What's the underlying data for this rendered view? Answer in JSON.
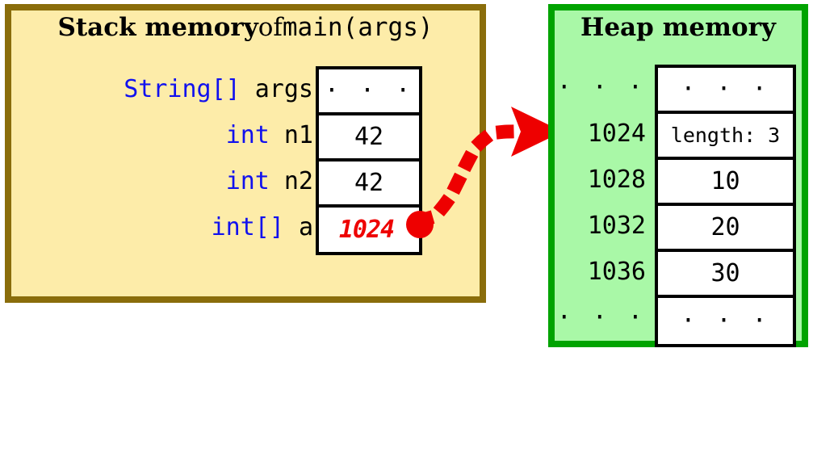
{
  "colors": {
    "stack_fill": "#fdeca9",
    "stack_border": "#8a6d0b",
    "heap_fill": "#a9f8a7",
    "heap_border": "#00a300",
    "pointer_red": "#ee0000",
    "type_blue": "#1111ee",
    "text_black": "#000000",
    "cell_fill": "#ffffff"
  },
  "stack": {
    "title": {
      "bold_part": "Stack memory",
      "middle_part": " of ",
      "mono_part": "main(args)"
    },
    "rows": [
      {
        "type": "String[]",
        "name": "args",
        "value": "· · ·",
        "value_style": "dots"
      },
      {
        "type": "int",
        "name": "n1",
        "value": "42",
        "value_style": "plain"
      },
      {
        "type": "int",
        "name": "n2",
        "value": "42",
        "value_style": "plain"
      },
      {
        "type": "int[]",
        "name": "a",
        "value": "1024",
        "value_style": "pointer"
      }
    ]
  },
  "heap": {
    "title": "Heap memory",
    "rows": [
      {
        "address": "· · ·",
        "value": "· · ·",
        "value_style": "dots"
      },
      {
        "address": "1024",
        "value": "length: 3",
        "value_style": "length"
      },
      {
        "address": "1028",
        "value": "10",
        "value_style": "plain"
      },
      {
        "address": "1032",
        "value": "20",
        "value_style": "plain"
      },
      {
        "address": "1036",
        "value": "30",
        "value_style": "plain"
      },
      {
        "address": "· · ·",
        "value": "· · ·",
        "value_style": "dots"
      }
    ]
  },
  "pointer_arrow": {
    "label": "reference-from-a-to-heap-1024",
    "from": "stack int[] a cell",
    "to": "heap address 1024",
    "color": "#ee0000",
    "style": "dashed-curve-with-arrowhead"
  }
}
